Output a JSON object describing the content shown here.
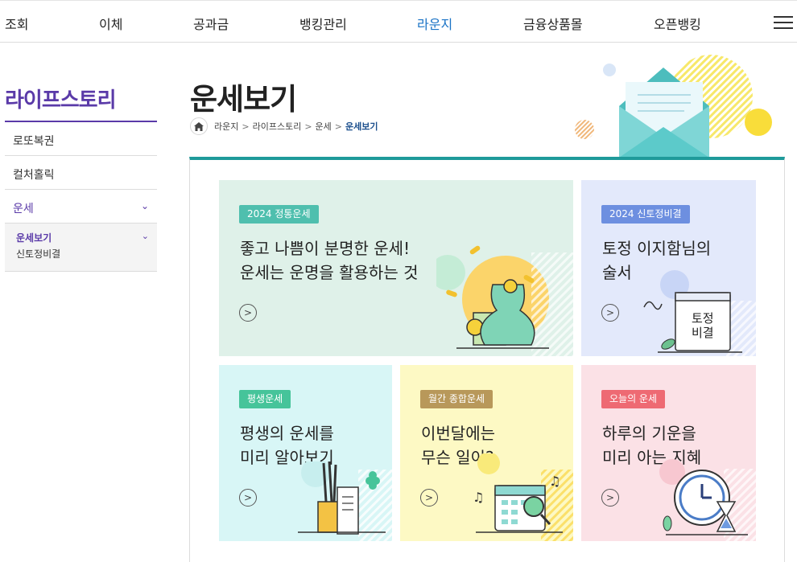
{
  "nav": {
    "items": [
      "조회",
      "이체",
      "공과금",
      "뱅킹관리",
      "라운지",
      "금융상품몰",
      "오픈뱅킹"
    ],
    "active": "라운지"
  },
  "sidebar": {
    "title": "라이프스토리",
    "items": [
      "로또복권",
      "컬처홀릭",
      "운세"
    ],
    "submenu": [
      "운세보기",
      "신토정비결"
    ]
  },
  "page": {
    "title": "운세보기",
    "breadcrumb": [
      "라운지",
      "라이프스토리",
      "운세",
      "운세보기"
    ]
  },
  "cards": [
    {
      "badge": "2024 정통운세",
      "lines": [
        "좋고 나쁨이 분명한 운세!",
        "운세는 운명을 활용하는 것"
      ],
      "bg": "#dff1e9",
      "badge_color": "#4fbfae"
    },
    {
      "badge": "2024 신토정비결",
      "lines": [
        "토정 이지함님의",
        "술서"
      ],
      "bg": "#e3e9fb",
      "badge_color": "#6d8fe0",
      "book_label": [
        "토정",
        "비결"
      ]
    },
    {
      "badge": "평생운세",
      "lines": [
        "평생의 운세를",
        "미리 알아보기"
      ],
      "bg": "#d8f6f6",
      "badge_color": "#46c49a"
    },
    {
      "badge": "월간 종합운세",
      "lines": [
        "이번달에는",
        "무슨 일이?"
      ],
      "bg": "#fdf9c4",
      "badge_color": "#b8985a"
    },
    {
      "badge": "오늘의 운세",
      "lines": [
        "하루의 기운을",
        "미리 아는 지혜"
      ],
      "bg": "#fbe1e6",
      "badge_color": "#ee6a73"
    }
  ],
  "colors": {
    "accent": "#5a3aa8",
    "nav_active": "#1a73c6",
    "teal": "#1f9a9a"
  }
}
